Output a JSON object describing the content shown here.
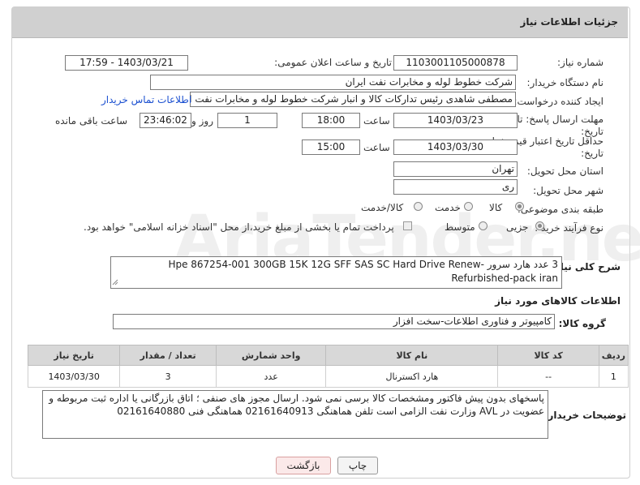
{
  "header": {
    "title": "جزئیات اطلاعات نیاز"
  },
  "form": {
    "need_number_label": "شماره نیاز:",
    "need_number": "1103001105000878",
    "announce_label": "تاریخ و ساعت اعلان عمومی:",
    "announce_value": "1403/03/21 - 17:59",
    "buyer_org_label": "نام دستگاه خریدار:",
    "buyer_org": "شرکت خطوط لوله و مخابرات نفت ایران",
    "creator_label": "ایجاد کننده درخواست:",
    "creator": "مصطفی  شاهدی رئیس تدارکات کالا و انبار شرکت خطوط لوله و مخابرات نفت ایر",
    "contact_link": "اطلاعات تماس خریدار",
    "reply_deadline_label": "مهلت ارسال پاسخ: تا",
    "reply_deadline_label2": "تاریخ:",
    "reply_date": "1403/03/23",
    "time_label": "ساعت",
    "reply_time": "18:00",
    "days_value": "1",
    "days_label": "روز و",
    "remaining_time": "23:46:02",
    "remaining_label": "ساعت باقی مانده",
    "price_validity_label": "حداقل تاریخ اعتبار قیمت: تا",
    "price_validity_label2": "تاریخ:",
    "price_date": "1403/03/30",
    "price_time": "15:00",
    "province_label": "استان محل تحویل:",
    "province": "تهران",
    "city_label": "شهر محل تحویل:",
    "city": "ری",
    "category_label": "طبقه بندی موضوعی:",
    "category_options": [
      "کالا",
      "خدمت",
      "کالا/خدمت"
    ],
    "category_selected": "کالا",
    "process_label": "نوع فرآیند خرید :",
    "process_options": [
      "جزیی",
      "متوسط"
    ],
    "process_selected": "جزیی",
    "payment_note": "پرداخت تمام یا بخشی از مبلغ خرید،از محل \"اسناد خزانه اسلامی\" خواهد بود."
  },
  "description": {
    "label": "شرح کلی نیاز:",
    "text": "3 عدد هارد سرور  Hpe 867254-001 300GB 15K 12G SFF SAS SC Hard Drive Renew-Refurbished-pack iran"
  },
  "goods_info": {
    "title": "اطلاعات کالاهای مورد نیاز",
    "group_label": "گروه کالا:",
    "group_value": "کامپیوتر و فناوری اطلاعات-سخت افزار"
  },
  "table": {
    "headers": [
      "ردیف",
      "کد کالا",
      "نام کالا",
      "واحد شمارش",
      "تعداد / مقدار",
      "تاریخ نیاز"
    ],
    "rows": [
      [
        "1",
        "--",
        "هارد اکسترنال",
        "عدد",
        "3",
        "1403/03/30"
      ]
    ]
  },
  "buyer_notes": {
    "label": "توضیحات خریدار:",
    "text": "پاسخهای بدون پیش فاکتور ومشخصات کالا برسی نمی شود. ارسال مجوز های صنفی ؛ اتاق بازرگانی یا اداره ثبت  مربوطه و عضویت در AVL وزارت نفت الزامی است تلفن هماهنگی  02161640913  هماهنگی فنی 02161640880"
  },
  "buttons": {
    "print": "چاپ",
    "back": "بازگشت"
  },
  "watermark": "AriaTender.net"
}
